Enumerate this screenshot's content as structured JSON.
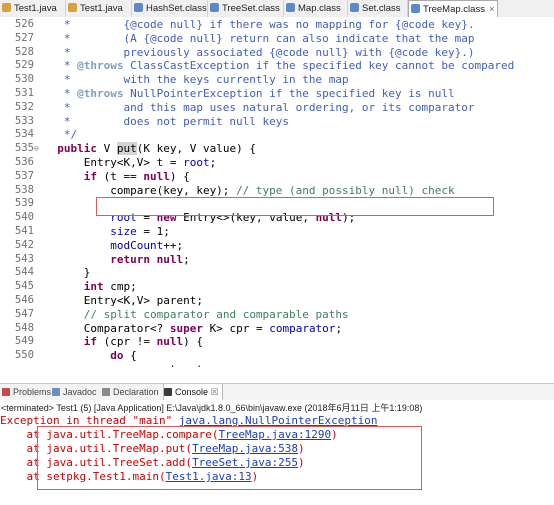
{
  "tabs": [
    {
      "label": "Test1.java",
      "icon": "java-file-icon",
      "kind": "java"
    },
    {
      "label": "Test1.java",
      "icon": "java-file-icon",
      "kind": "java"
    },
    {
      "label": "HashSet.class",
      "icon": "class-file-icon",
      "kind": "cls"
    },
    {
      "label": "TreeSet.class",
      "icon": "class-file-icon",
      "kind": "cls"
    },
    {
      "label": "Map.class",
      "icon": "class-file-icon",
      "kind": "cls"
    },
    {
      "label": "Set.class",
      "icon": "class-file-icon",
      "kind": "cls"
    },
    {
      "label": "TreeMap.class",
      "icon": "class-file-icon",
      "kind": "cls",
      "active": true,
      "close": "×"
    }
  ],
  "editor": {
    "lines": [
      {
        "n": "526",
        "t": [
          [
            "jd",
            "   *        {@code null} if there was no mapping for {@code key}."
          ]
        ]
      },
      {
        "n": "527",
        "t": [
          [
            "jd",
            "   *        (A {@code null} return can also indicate that the map"
          ]
        ]
      },
      {
        "n": "528",
        "t": [
          [
            "jd",
            "   *        previously associated {@code null} with {@code key}.)"
          ]
        ]
      },
      {
        "n": "529",
        "t": [
          [
            "jd",
            "   * "
          ],
          [
            "tg",
            "@throws"
          ],
          [
            "jd",
            " ClassCastException if the specified key cannot be compared"
          ]
        ]
      },
      {
        "n": "530",
        "t": [
          [
            "jd",
            "   *        with the keys currently in the map"
          ]
        ]
      },
      {
        "n": "531",
        "t": [
          [
            "jd",
            "   * "
          ],
          [
            "tg",
            "@throws"
          ],
          [
            "jd",
            " NullPointerException if the specified key is null"
          ]
        ]
      },
      {
        "n": "532",
        "t": [
          [
            "jd",
            "   *        and this map uses natural ordering, or its comparator"
          ]
        ]
      },
      {
        "n": "533",
        "t": [
          [
            "jd",
            "   *        does not permit null keys"
          ]
        ]
      },
      {
        "n": "534",
        "t": [
          [
            "jd",
            "   */"
          ]
        ]
      },
      {
        "n": "535",
        "fold": "⊖",
        "t": [
          [
            "pl",
            "  "
          ],
          [
            "kw",
            "public"
          ],
          [
            "pl",
            " V "
          ],
          [
            "hl",
            "put"
          ],
          [
            "pl",
            "(K key, V value) {"
          ]
        ]
      },
      {
        "n": "536",
        "t": [
          [
            "pl",
            "      Entry<K,V> t = "
          ],
          [
            "fd",
            "root"
          ],
          [
            "pl",
            ";"
          ]
        ]
      },
      {
        "n": "537",
        "t": [
          [
            "pl",
            "      "
          ],
          [
            "kw",
            "if"
          ],
          [
            "pl",
            " (t == "
          ],
          [
            "kw",
            "null"
          ],
          [
            "pl",
            ") {"
          ]
        ]
      },
      {
        "n": "538",
        "t": [
          [
            "pl",
            "          compare(key, key); "
          ],
          [
            "cm",
            "// type (and possibly null) check"
          ]
        ]
      },
      {
        "n": "539",
        "t": [
          [
            "pl",
            ""
          ]
        ]
      },
      {
        "n": "540",
        "t": [
          [
            "pl",
            "          "
          ],
          [
            "fd",
            "root"
          ],
          [
            "pl",
            " = "
          ],
          [
            "kw",
            "new"
          ],
          [
            "pl",
            " Entry<>(key, value, "
          ],
          [
            "kw",
            "null"
          ],
          [
            "pl",
            ");"
          ]
        ]
      },
      {
        "n": "541",
        "t": [
          [
            "pl",
            "          "
          ],
          [
            "fd",
            "size"
          ],
          [
            "pl",
            " = 1;"
          ]
        ]
      },
      {
        "n": "542",
        "t": [
          [
            "pl",
            "          "
          ],
          [
            "fd",
            "modCount"
          ],
          [
            "pl",
            "++;"
          ]
        ]
      },
      {
        "n": "543",
        "t": [
          [
            "pl",
            "          "
          ],
          [
            "kw",
            "return"
          ],
          [
            "pl",
            " "
          ],
          [
            "kw",
            "null"
          ],
          [
            "pl",
            ";"
          ]
        ]
      },
      {
        "n": "544",
        "t": [
          [
            "pl",
            "      }"
          ]
        ]
      },
      {
        "n": "545",
        "t": [
          [
            "pl",
            "      "
          ],
          [
            "kw",
            "int"
          ],
          [
            "pl",
            " cmp;"
          ]
        ]
      },
      {
        "n": "546",
        "t": [
          [
            "pl",
            "      Entry<K,V> parent;"
          ]
        ]
      },
      {
        "n": "547",
        "t": [
          [
            "pl",
            "      "
          ],
          [
            "cm",
            "// split comparator and comparable paths"
          ]
        ]
      },
      {
        "n": "548",
        "t": [
          [
            "pl",
            "      Comparator<? "
          ],
          [
            "kw",
            "super"
          ],
          [
            "pl",
            " K> cpr = "
          ],
          [
            "fd",
            "comparator"
          ],
          [
            "pl",
            ";"
          ]
        ]
      },
      {
        "n": "549",
        "t": [
          [
            "pl",
            "      "
          ],
          [
            "kw",
            "if"
          ],
          [
            "pl",
            " (cpr != "
          ],
          [
            "kw",
            "null"
          ],
          [
            "pl",
            ") {"
          ]
        ]
      },
      {
        "n": "550",
        "t": [
          [
            "pl",
            "          "
          ],
          [
            "kw",
            "do"
          ],
          [
            "pl",
            " {"
          ]
        ]
      },
      {
        "n": "",
        "t": [
          [
            "pl",
            "              parent = t;"
          ]
        ]
      }
    ]
  },
  "console_tabs": [
    {
      "label": "Problems",
      "icon": "problems-icon",
      "color": "#c24a4a"
    },
    {
      "label": "Javadoc",
      "icon": "javadoc-icon",
      "color": "#6a8fc7"
    },
    {
      "label": "Declaration",
      "icon": "declaration-icon",
      "color": "#8a8a8a"
    },
    {
      "label": "Console",
      "icon": "console-icon",
      "color": "#3a3a3a",
      "active": true,
      "close": "☒"
    }
  ],
  "console": {
    "terminated": "<terminated> Test1 (5) [Java Application] E:\\Java\\jdk1.8.0_66\\bin\\javaw.exe (2018年6月11日 上午1:19:08)",
    "exception_prefix": "Exception in thread \"main\" ",
    "exception_class": "java.lang.NullPointerException",
    "stack": [
      {
        "at": "    at java.util.TreeMap.compare(",
        "link": "TreeMap.java:1290",
        "end": ")"
      },
      {
        "at": "    at java.util.TreeMap.put(",
        "link": "TreeMap.java:538",
        "end": ")"
      },
      {
        "at": "    at java.util.TreeSet.add(",
        "link": "TreeSet.java:255",
        "end": ")"
      },
      {
        "at": "    at setpkg.Test1.main(",
        "link": "Test1.java:13",
        "end": ")"
      }
    ]
  },
  "colors": {
    "highlight_box": "#e05a5a",
    "keyword": "#7f0055",
    "comment": "#3f7f5f",
    "javadoc": "#3f5fbf",
    "error": "#d00000",
    "link": "#1a3fbf"
  }
}
